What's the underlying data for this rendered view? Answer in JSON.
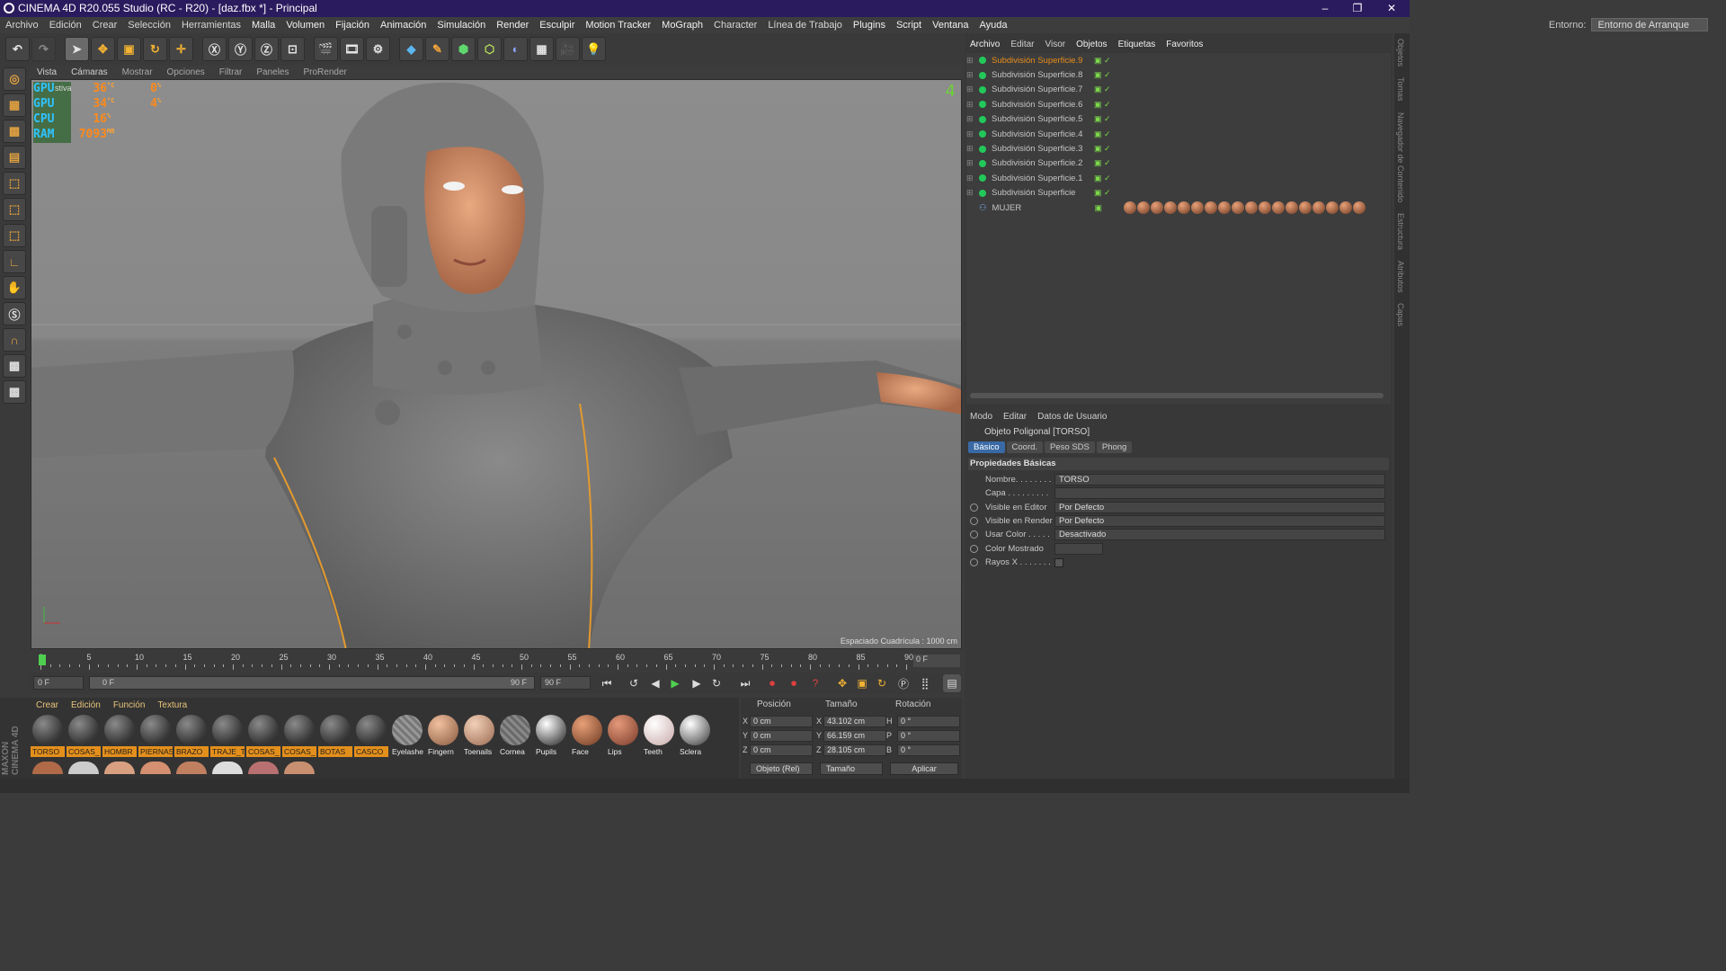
{
  "window": {
    "title": "CINEMA 4D R20.055 Studio (RC - R20) - [daz.fbx *] - Principal",
    "minimize": "–",
    "restore": "❐",
    "close": "✕"
  },
  "menu": [
    "Archivo",
    "Edición",
    "Crear",
    "Selección",
    "Herramientas",
    "Malla",
    "Volumen",
    "Fijación",
    "Animación",
    "Simulación",
    "Render",
    "Esculpir",
    "Motion Tracker",
    "MoGraph",
    "Character",
    "Línea de Trabajo",
    "Plugins",
    "Script",
    "Ventana",
    "Ayuda"
  ],
  "entorno": {
    "label": "Entorno:",
    "value": "Entorno de Arranque"
  },
  "viewport": {
    "menu": [
      "Vista",
      "Cámaras",
      "Mostrar",
      "Opciones",
      "Filtrar",
      "Paneles",
      "ProRender"
    ],
    "hud_tag": "stiva",
    "hud": [
      {
        "k": "GPU",
        "v": "36",
        "u": "°C",
        "v2": "0",
        "u2": "%"
      },
      {
        "k": "GPU",
        "v": "34",
        "u": "°C",
        "v2": "4",
        "u2": "%"
      },
      {
        "k": "CPU",
        "v": "16",
        "u": "%",
        "v2": "",
        "u2": ""
      },
      {
        "k": "RAM",
        "v": "7093",
        "u": "MB",
        "v2": "",
        "u2": ""
      }
    ],
    "view_number": "4",
    "grid_spacing": "Espaciado Cuadrícula : 1000 cm"
  },
  "timeline": {
    "ticks": [
      "0",
      "5",
      "10",
      "15",
      "20",
      "25",
      "30",
      "35",
      "40",
      "45",
      "50",
      "55",
      "60",
      "65",
      "70",
      "75",
      "80",
      "85",
      "90"
    ],
    "end_frame": "0 F"
  },
  "transport": {
    "start": "0 F",
    "range_start": "0 F",
    "range_end": "90 F",
    "end": "90 F"
  },
  "materials": {
    "menu": [
      "Crear",
      "Edición",
      "Función",
      "Textura"
    ],
    "items": [
      {
        "label": "TORSO",
        "hl": true
      },
      {
        "label": "COSAS_",
        "hl": true
      },
      {
        "label": "HOMBR",
        "hl": true
      },
      {
        "label": "PIERNAS",
        "hl": true
      },
      {
        "label": "BRAZO",
        "hl": true
      },
      {
        "label": "TRAJE_T",
        "hl": true
      },
      {
        "label": "COSAS_",
        "hl": true
      },
      {
        "label": "COSAS_",
        "hl": true
      },
      {
        "label": "BOTAS",
        "hl": true
      },
      {
        "label": "CASCO",
        "hl": true
      },
      {
        "label": "Eyelashe",
        "hl": false
      },
      {
        "label": "Fingern",
        "hl": false
      },
      {
        "label": "Toenails",
        "hl": false
      },
      {
        "label": "Cornea",
        "hl": false
      },
      {
        "label": "Pupils",
        "hl": false
      },
      {
        "label": "Face",
        "hl": false
      },
      {
        "label": "Lips",
        "hl": false
      },
      {
        "label": "Teeth",
        "hl": false
      },
      {
        "label": "Sclera",
        "hl": false
      }
    ],
    "brand1": "MAXON",
    "brand2": "CINEMA 4D"
  },
  "coords": {
    "headers": [
      "Posición",
      "Tamaño",
      "Rotación"
    ],
    "rows": [
      {
        "a": "X",
        "p": "0 cm",
        "b": "X",
        "s": "43.102 cm",
        "c": "H",
        "r": "0 °"
      },
      {
        "a": "Y",
        "p": "0 cm",
        "b": "Y",
        "s": "66.159 cm",
        "c": "P",
        "r": "0 °"
      },
      {
        "a": "Z",
        "p": "0 cm",
        "b": "Z",
        "s": "28.105 cm",
        "c": "B",
        "r": "0 °"
      }
    ],
    "mode": "Objeto (Rel)",
    "size_mode": "Tamaño",
    "apply": "Aplicar"
  },
  "objects": {
    "menu": [
      "Archivo",
      "Editar",
      "Visor",
      "Objetos",
      "Etiquetas",
      "Favoritos"
    ],
    "items": [
      "Subdivisión Superficie.9",
      "Subdivisión Superficie.8",
      "Subdivisión Superficie.7",
      "Subdivisión Superficie.6",
      "Subdivisión Superficie.5",
      "Subdivisión Superficie.4",
      "Subdivisión Superficie.3",
      "Subdivisión Superficie.2",
      "Subdivisión Superficie.1",
      "Subdivisión Superficie"
    ],
    "mujer": "MUJER"
  },
  "attributes": {
    "menu": [
      "Modo",
      "Editar",
      "Datos de Usuario"
    ],
    "title": "Objeto Poligonal [TORSO]",
    "tabs": [
      "Básico",
      "Coord.",
      "Peso SDS",
      "Phong"
    ],
    "section": "Propiedades Básicas",
    "props": [
      {
        "label": "Nombre. . . . . . . .",
        "value": "TORSO"
      },
      {
        "label": "Capa . . . . . . . . .",
        "value": ""
      },
      {
        "label": "Visible en Editor",
        "value": "Por Defecto"
      },
      {
        "label": "Visible en Render",
        "value": "Por Defecto"
      },
      {
        "label": "Usar Color . . . . .",
        "value": "Desactivado"
      },
      {
        "label": "Color Mostrado",
        "value": ""
      },
      {
        "label": "Rayos X . . . . . . .",
        "value": ""
      }
    ]
  },
  "sidetabs": [
    "Objetos",
    "Tomas",
    "Navegador de Contenido",
    "Estructura",
    "Atributos",
    "Capas"
  ],
  "colors": {
    "accent": "#e38f1c",
    "title_bg": "#2a1b5e"
  }
}
